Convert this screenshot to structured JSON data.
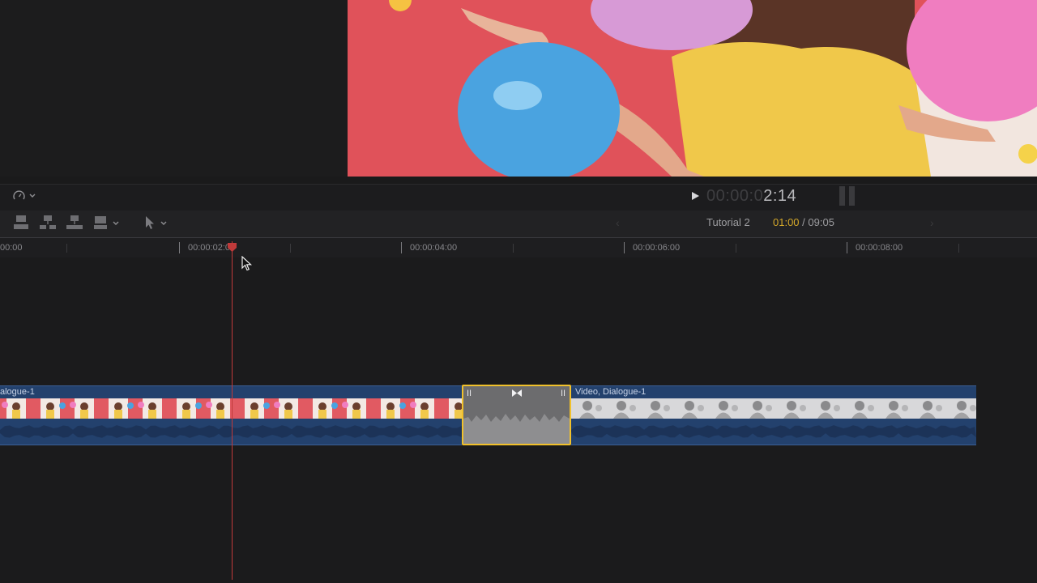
{
  "viewer": {
    "timecode_dim": "00:00:0",
    "timecode_lit": "2:14"
  },
  "timeline_toolbar": {
    "project_name": "Tutorial 2",
    "current_time": "01:00",
    "separator": " / ",
    "total_duration": "09:05",
    "prev_label": "‹",
    "next_label": "›"
  },
  "ruler": {
    "labels": [
      "00:00",
      "00:00:02:00",
      "00:00:04:00",
      "00:00:06:00",
      "00:00:08:00"
    ]
  },
  "clips": [
    {
      "name": "alogue-1"
    },
    {
      "name": "Video, Dialogue-1"
    }
  ],
  "colors": {
    "clip_blue": "#23416d",
    "selection_yellow": "#f1c12b",
    "playhead_red": "#c03a3a",
    "timecode_accent": "#d4a82a"
  },
  "icons": [
    "speedometer-icon",
    "play-icon",
    "append-clip-icon",
    "insert-clip-icon",
    "connect-clip-icon",
    "overwrite-clip-icon",
    "chevron-down-icon",
    "select-arrow-icon",
    "audio-meter-icon",
    "transition-bowtie-icon",
    "mouse-cursor-icon"
  ]
}
